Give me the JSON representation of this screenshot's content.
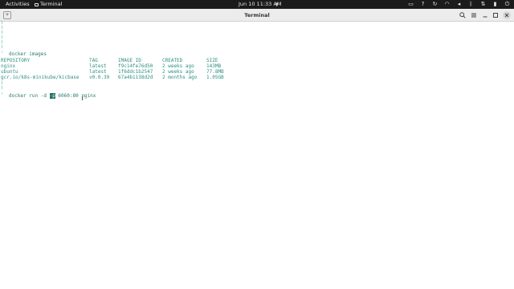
{
  "topbar": {
    "activities": "Activities",
    "app_name": "Terminal",
    "clock": "Jun 10  11:33 AM",
    "tray_icons": [
      "screen-icon",
      "question-icon",
      "updates-icon",
      "wifi-icon",
      "speaker-icon",
      "bluetooth-icon",
      "network-icon",
      "battery-icon",
      "power-icon"
    ]
  },
  "window": {
    "title": "Terminal",
    "buttons": [
      "search-icon",
      "menu-icon",
      "minimize-icon",
      "maximize-icon",
      "close-icon"
    ]
  },
  "terminal": {
    "cmd1": "docker images",
    "headers": [
      "REPOSITORY",
      "TAG",
      "IMAGE ID",
      "CREATED",
      "SIZE"
    ],
    "rows": [
      [
        "nginx",
        "latest",
        "f9c14fe76d50",
        "2 weeks ago",
        "143MB"
      ],
      [
        "ubuntu",
        "latest",
        "1f6ddc1b2547",
        "2 weeks ago",
        "77.8MB"
      ],
      [
        "gcr.io/k8s-minikube/kicbase",
        "v0.0.39",
        "67a4b1138d2d",
        "2 months ago",
        "1.05GB"
      ]
    ],
    "cmd2_before": "docker run -d ",
    "cmd2_selected": "-p",
    "cmd2_after": " 6060:80 nginx"
  },
  "colors": {
    "prompt": "#3fae9c",
    "selection": "#1d6f63",
    "topbar": "#1b1b1b"
  }
}
